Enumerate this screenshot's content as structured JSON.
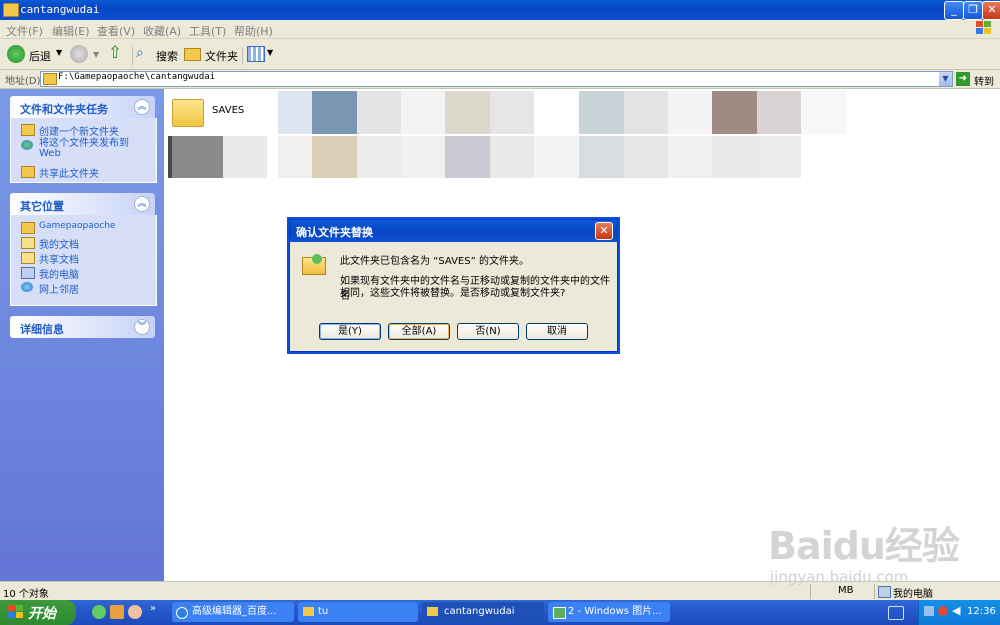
{
  "window": {
    "title": "cantangwudai"
  },
  "menu": [
    "文件(F)",
    "编辑(E)",
    "查看(V)",
    "收藏(A)",
    "工具(T)",
    "帮助(H)"
  ],
  "toolbar": {
    "back": "后退",
    "search": "搜索",
    "folders": "文件夹"
  },
  "address": {
    "label": "地址(D)",
    "path": "F:\\Gamepaopaoche\\cantangwudai",
    "go": "转到"
  },
  "left_pane": {
    "tasks": {
      "title": "文件和文件夹任务",
      "items": [
        "创建一个新文件夹",
        "将这个文件夹发布到Web",
        "共享此文件夹"
      ]
    },
    "places": {
      "title": "其它位置",
      "items": [
        "Gamepaopaoche",
        "我的文档",
        "共享文档",
        "我的电脑",
        "网上邻居"
      ]
    },
    "details": {
      "title": "详细信息"
    }
  },
  "main": {
    "folder_name": "SAVES"
  },
  "dialog": {
    "title": "确认文件夹替换",
    "line1": "此文件夹已包含名为 “SAVES” 的文件夹。",
    "line2": "如果现有文件夹中的文件名与正移动或复制的文件夹中的文件名",
    "line3": "相同，这些文件将被替换。是否移动或复制文件夹?",
    "buttons": {
      "yes": "是(Y)",
      "all": "全部(A)",
      "no": "否(N)",
      "cancel": "取消"
    }
  },
  "status": {
    "count": "10 个对象",
    "size": "MB",
    "location": "我的电脑"
  },
  "taskbar": {
    "start": "开始",
    "tasks": [
      "高级编辑器_百度...",
      "tu",
      "cantangwudai",
      "2 - Windows 图片..."
    ],
    "clock": "12:36"
  },
  "watermark": {
    "brand": "Baidu经验",
    "url": "jingyan.baidu.com"
  }
}
